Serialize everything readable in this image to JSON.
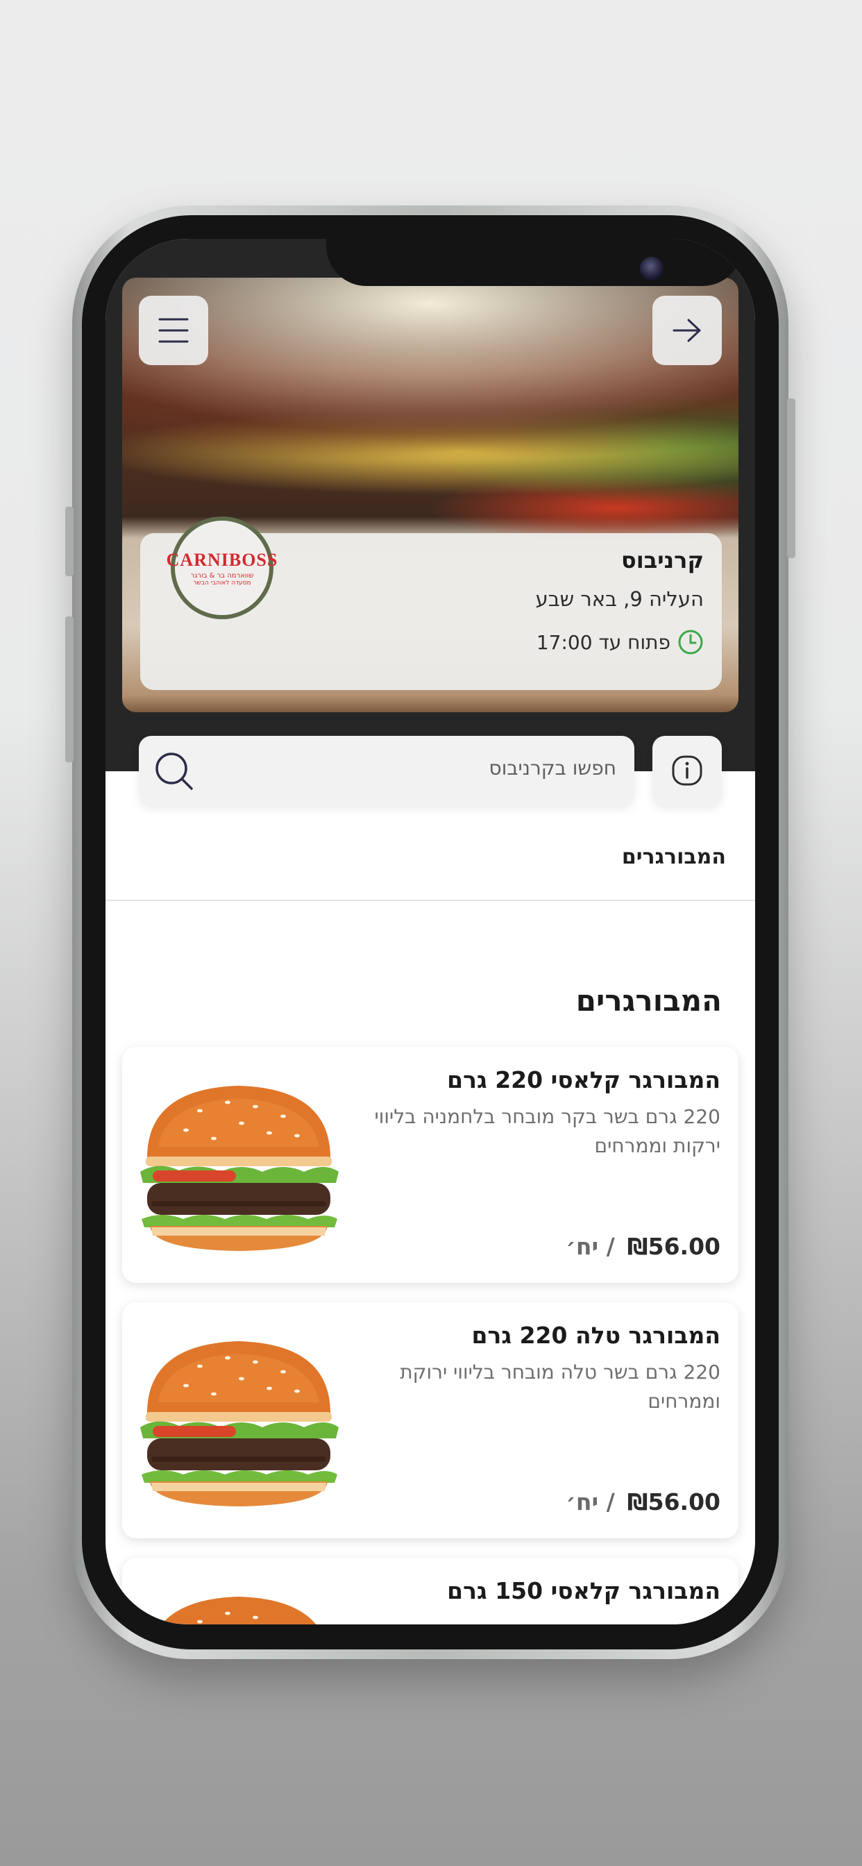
{
  "header": {
    "menu_icon": "hamburger-menu-icon",
    "back_icon": "arrow-right-icon"
  },
  "restaurant": {
    "name": "קרניבוס",
    "address": "העליה 9, באר שבע",
    "hours": "פתוח עד 17:00",
    "hours_icon": "clock-icon",
    "logo_text": "CARNIBOSS",
    "logo_sub": "שווארמה בר & בורגר",
    "logo_sub2": "מסעדה לאוהבי הבשר"
  },
  "search": {
    "placeholder": "חפשו בקרניבוס",
    "icon": "search-icon",
    "info_icon": "info-icon"
  },
  "category_tabs": [
    "המבורגרים"
  ],
  "section": {
    "title": "המבורגרים"
  },
  "items": [
    {
      "title": "המבורגר קלאסי 220 גרם",
      "description": "220 גרם בשר בקר מובחר בלחמניה בליווי ירקות וממרחים",
      "price": "₪56.00",
      "unit": "/ יח׳"
    },
    {
      "title": "המבורגר טלה 220 גרם",
      "description": "220 גרם בשר טלה מובחר בליווי ירוקת וממרחים",
      "price": "₪56.00",
      "unit": "/ יח׳"
    },
    {
      "title": "המבורגר קלאסי 150 גרם",
      "description": "",
      "price": "",
      "unit": ""
    }
  ],
  "colors": {
    "accent_green": "#3aa84a",
    "logo_red": "#d42a2f"
  }
}
